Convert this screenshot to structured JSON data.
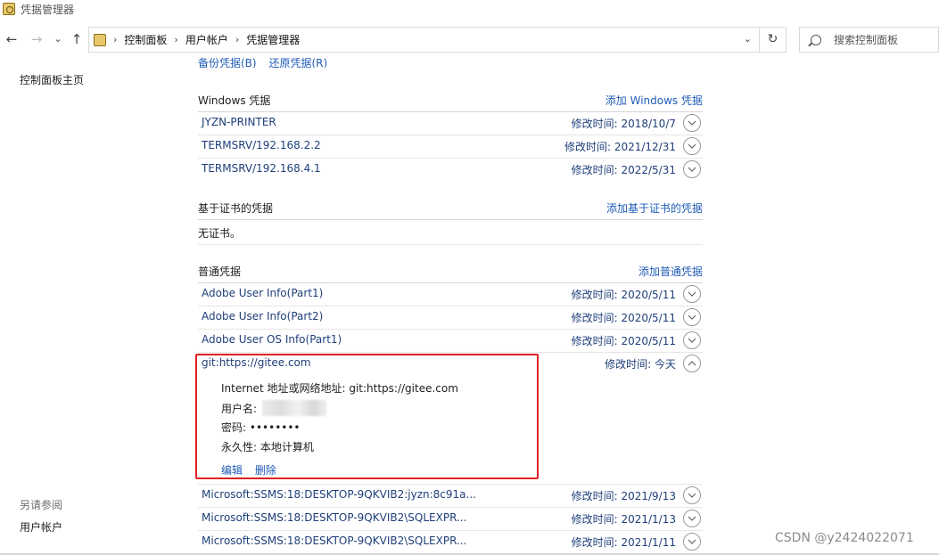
{
  "window": {
    "title": "凭据管理器"
  },
  "nav": {
    "back": "←",
    "forward": "→",
    "recent": "⌄",
    "up": "↑",
    "breadcrumbs": [
      "控制面板",
      "用户帐户",
      "凭据管理器"
    ],
    "refresh": "↻",
    "search_placeholder": "搜索控制面板"
  },
  "left": {
    "home": "控制面板主页",
    "see_also": "另请参阅",
    "see_also_link": "用户帐户"
  },
  "top_links": {
    "backup": "备份凭据(B)",
    "restore": "还原凭据(R)"
  },
  "windows_creds": {
    "heading": "Windows 凭据",
    "add": "添加 Windows 凭据",
    "items": [
      {
        "name": "JYZN-PRINTER",
        "modified": "修改时间:  2018/10/7"
      },
      {
        "name": "TERMSRV/192.168.2.2",
        "modified": "修改时间:  2021/12/31"
      },
      {
        "name": "TERMSRV/192.168.4.1",
        "modified": "修改时间:  2022/5/31"
      }
    ]
  },
  "cert_creds": {
    "heading": "基于证书的凭据",
    "add": "添加基于证书的凭据",
    "empty": "无证书。"
  },
  "generic_creds": {
    "heading": "普通凭据",
    "add": "添加普通凭据",
    "items": [
      {
        "name": "Adobe User Info(Part1)",
        "modified": "修改时间:  2020/5/11"
      },
      {
        "name": "Adobe User Info(Part2)",
        "modified": "修改时间:  2020/5/11"
      },
      {
        "name": "Adobe User OS Info(Part1)",
        "modified": "修改时间:  2020/5/11"
      }
    ],
    "expanded": {
      "name": "git:https://gitee.com",
      "modified": "修改时间:  今天",
      "address_label": "Internet 地址或网络地址:",
      "address_value": "git:https://gitee.com",
      "username_label": "用户名:",
      "password_label": "密码:",
      "password_value": "••••••••",
      "persistence_label": "永久性:",
      "persistence_value": "本地计算机",
      "edit": "编辑",
      "delete": "删除"
    },
    "more_items": [
      {
        "name": "Microsoft:SSMS:18:DESKTOP-9QKVIB2:jyzn:8c91a...",
        "modified": "修改时间:  2021/9/13"
      },
      {
        "name": "Microsoft:SSMS:18:DESKTOP-9QKVIB2\\SQLEXPR...",
        "modified": "修改时间:  2021/1/13"
      },
      {
        "name": "Microsoft:SSMS:18:DESKTOP-9QKVIB2\\SQLEXPR...",
        "modified": "修改时间:  2021/1/11"
      }
    ]
  },
  "watermark": "CSDN @y2424022071",
  "colors": {
    "link": "#1f5cb8",
    "item_text": "#1f3f7a",
    "highlight": "#e02020"
  }
}
